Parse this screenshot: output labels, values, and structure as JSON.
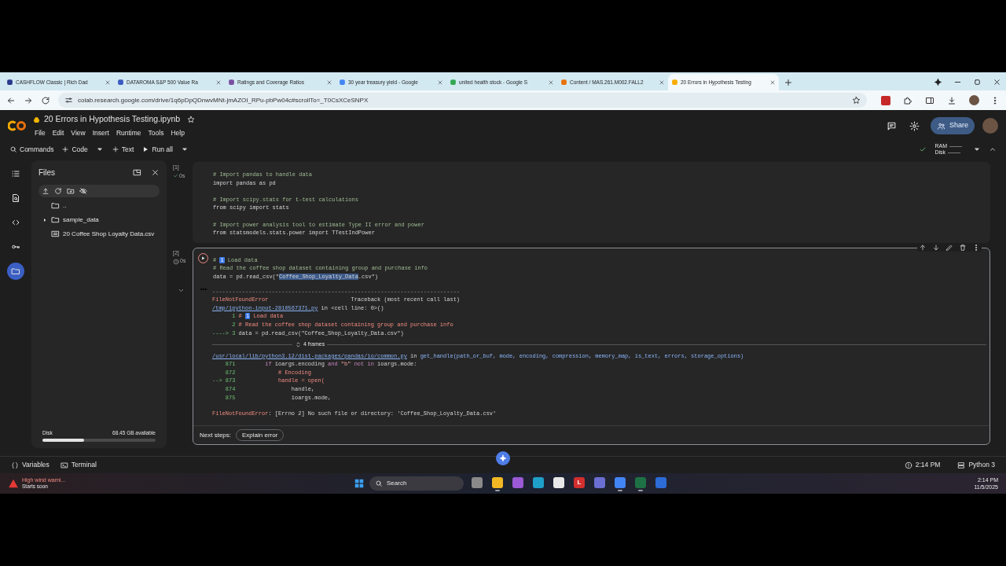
{
  "browser": {
    "tabs": [
      {
        "title": "CASHFLOW Classic | Rich Dad",
        "color": "#2b3a8c",
        "selected": false
      },
      {
        "title": "DATAROMA S&P 500 Value Ra",
        "color": "#3a5bbf",
        "selected": false
      },
      {
        "title": "Ratings and Coverage Ratios",
        "color": "#7b4fa0",
        "selected": false
      },
      {
        "title": "30 year treasury yield - Google",
        "color": "#4285f4",
        "selected": false
      },
      {
        "title": "united health stock - Google S",
        "color": "#34a853",
        "selected": false
      },
      {
        "title": "Content / MAS.261.M002.FALL2",
        "color": "#e8710a",
        "selected": false
      },
      {
        "title": "20 Errors in Hypothesis Testing",
        "color": "#f9ab00",
        "selected": true
      }
    ],
    "url": "colab.research.google.com/drive/1q6pDpQDnwvMNt-jmAZOI_RPu-pbPw04c#scrollTo=_T0CsXCeSNPX"
  },
  "notebook": {
    "title": "20 Errors in Hypothesis Testing.ipynb",
    "menu": [
      "File",
      "Edit",
      "View",
      "Insert",
      "Runtime",
      "Tools",
      "Help"
    ],
    "share": "Share"
  },
  "toolbar": {
    "items": [
      {
        "kind": "search",
        "label": "Commands",
        "dropdown": false
      },
      {
        "kind": "add",
        "label": "Code",
        "dropdown": true
      },
      {
        "kind": "add",
        "label": "Text",
        "dropdown": false
      },
      {
        "kind": "run",
        "label": "Run all",
        "dropdown": true
      }
    ],
    "ram_label": "RAM",
    "disk_label": "Disk"
  },
  "rail": [
    {
      "kind": "toc",
      "selected": false
    },
    {
      "kind": "find",
      "selected": false
    },
    {
      "kind": "snippets",
      "selected": false
    },
    {
      "kind": "secrets",
      "selected": false
    },
    {
      "kind": "files",
      "selected": true
    }
  ],
  "files": {
    "title": "Files",
    "tree": [
      {
        "kind": "parent",
        "name": ".."
      },
      {
        "kind": "folder",
        "name": "sample_data"
      },
      {
        "kind": "csv",
        "name": "20 Coffee Shop Loyalty Data.csv"
      }
    ],
    "disk": {
      "label": "Disk",
      "available": "68.45 GB available",
      "level": 0.37
    }
  },
  "cells": [
    {
      "count": "[1]",
      "error": false,
      "time": "0s",
      "focused": false,
      "blocks": [
        [
          [
            {
              "kind": "comment",
              "text": "# Import pandas to handle data"
            }
          ],
          [
            {
              "kind": "plain",
              "text": "import pandas as pd"
            }
          ]
        ],
        [
          [
            {
              "kind": "comment",
              "text": "# Import scipy.stats for t-test calculations"
            }
          ],
          [
            {
              "kind": "plain",
              "text": "from scipy import stats"
            }
          ]
        ],
        [
          [
            {
              "kind": "comment",
              "text": "# Import power analysis tool to estimate Type II error and power"
            }
          ],
          [
            {
              "kind": "plain",
              "text": "from statsmodels.stats.power import TTestIndPower"
            }
          ]
        ]
      ]
    },
    {
      "count": "[2]",
      "error": true,
      "time": "0s",
      "focused": true,
      "blocks": [
        [
          [
            {
              "kind": "comment",
              "text": "# "
            },
            {
              "kind": "badge",
              "text": "1"
            },
            {
              "kind": "comment",
              "text": " Load data"
            }
          ],
          [
            {
              "kind": "comment",
              "text": "# Read the coffee shop dataset containing group and purchase info"
            }
          ],
          [
            {
              "kind": "plain",
              "text": "data = pd.read_csv(\"",
              "selected": false
            },
            {
              "kind": "plain",
              "text": "Coffee_Shop_Loyalty_Data",
              "selected": true
            },
            {
              "kind": "plain",
              "text": ".csv\")",
              "selected": false
            }
          ]
        ]
      ],
      "output": {
        "top": [
          [
            {
              "kind": "dash",
              "text": "---------------------------------------------------------------------------"
            }
          ],
          [
            {
              "kind": "error",
              "text": "FileNotFoundError"
            },
            {
              "kind": "plain",
              "text": "                         Traceback (most recent call last)"
            }
          ],
          [
            {
              "kind": "link",
              "text": "/tmp/ipython-input-2810567371.py"
            },
            {
              "kind": "plain",
              "text": " in <cell line: 0>()"
            }
          ],
          [
            {
              "kind": "lineno",
              "text": "      1 "
            },
            {
              "kind": "error",
              "text": "# "
            },
            {
              "kind": "badge",
              "text": "1"
            },
            {
              "kind": "error",
              "text": " Load data"
            }
          ],
          [
            {
              "kind": "lineno",
              "text": "      2 "
            },
            {
              "kind": "error",
              "text": "# Read the coffee shop dataset containing group and purchase info"
            }
          ],
          [
            {
              "kind": "lineno",
              "text": "----> 3 "
            },
            {
              "kind": "plain",
              "text": "data = pd.read_csv(\"Coffee_Shop_Loyalty_Data.csv\")"
            }
          ]
        ],
        "frames": "4 frames",
        "bottom": [
          [
            {
              "kind": "link",
              "text": "/usr/local/lib/python3.12/dist-packages/pandas/io/common.py"
            },
            {
              "kind": "plain",
              "text": " in "
            },
            {
              "kind": "func",
              "text": "get_handle(path_or_buf, mode, encoding, compression, memory_map, is_text, errors, storage_options)"
            }
          ],
          [
            {
              "kind": "lineno",
              "text": "    871 "
            },
            {
              "kind": "keyword",
              "text": "        if"
            },
            {
              "kind": "plain",
              "text": " ioargs.encoding "
            },
            {
              "kind": "keyword",
              "text": "and"
            },
            {
              "kind": "string",
              "text": " \"b\" "
            },
            {
              "kind": "keyword",
              "text": "not in"
            },
            {
              "kind": "plain",
              "text": " ioargs.mode:"
            }
          ],
          [
            {
              "kind": "lineno",
              "text": "    872 "
            },
            {
              "kind": "error",
              "text": "            # Encoding"
            }
          ],
          [
            {
              "kind": "lineno",
              "text": "--> 873 "
            },
            {
              "kind": "error",
              "text": "            handle = open("
            }
          ],
          [
            {
              "kind": "lineno",
              "text": "    874 "
            },
            {
              "kind": "plain",
              "text": "                handle,"
            }
          ],
          [
            {
              "kind": "lineno",
              "text": "    875 "
            },
            {
              "kind": "plain",
              "text": "                ioargs.mode,"
            }
          ]
        ],
        "final": [
          {
            "kind": "error",
            "text": "FileNotFoundError"
          },
          {
            "kind": "plain",
            "text": ": [Errno 2] No such file or directory: 'Coffee_Shop_Loyalty_Data.csv'"
          }
        ],
        "next_label": "Next steps:",
        "next_button": "Explain error"
      }
    }
  ],
  "status_bar": {
    "variables": "Variables",
    "terminal": "Terminal",
    "time": "2:14 PM",
    "runtime": "Python 3"
  },
  "taskbar": {
    "weather_title": "High wind warni...",
    "weather_sub": "Starts soon",
    "search": "Search",
    "apps": [
      {
        "color": "#8a8a8a",
        "running": false
      },
      {
        "color": "#f2b824",
        "running": true
      },
      {
        "color": "#9b59d6",
        "running": false
      },
      {
        "color": "#1fa0c8",
        "running": false
      },
      {
        "color": "#e8e8e8",
        "running": false
      },
      {
        "color": "#d32f2f",
        "label": "L",
        "running": false
      },
      {
        "color": "#6b6fd1",
        "running": false
      },
      {
        "color": "#4285f4",
        "running": true
      },
      {
        "color": "#1e7145",
        "running": true
      },
      {
        "color": "#2d6bd6",
        "running": false
      }
    ],
    "time": "2:14 PM",
    "date": "11/5/2025"
  }
}
